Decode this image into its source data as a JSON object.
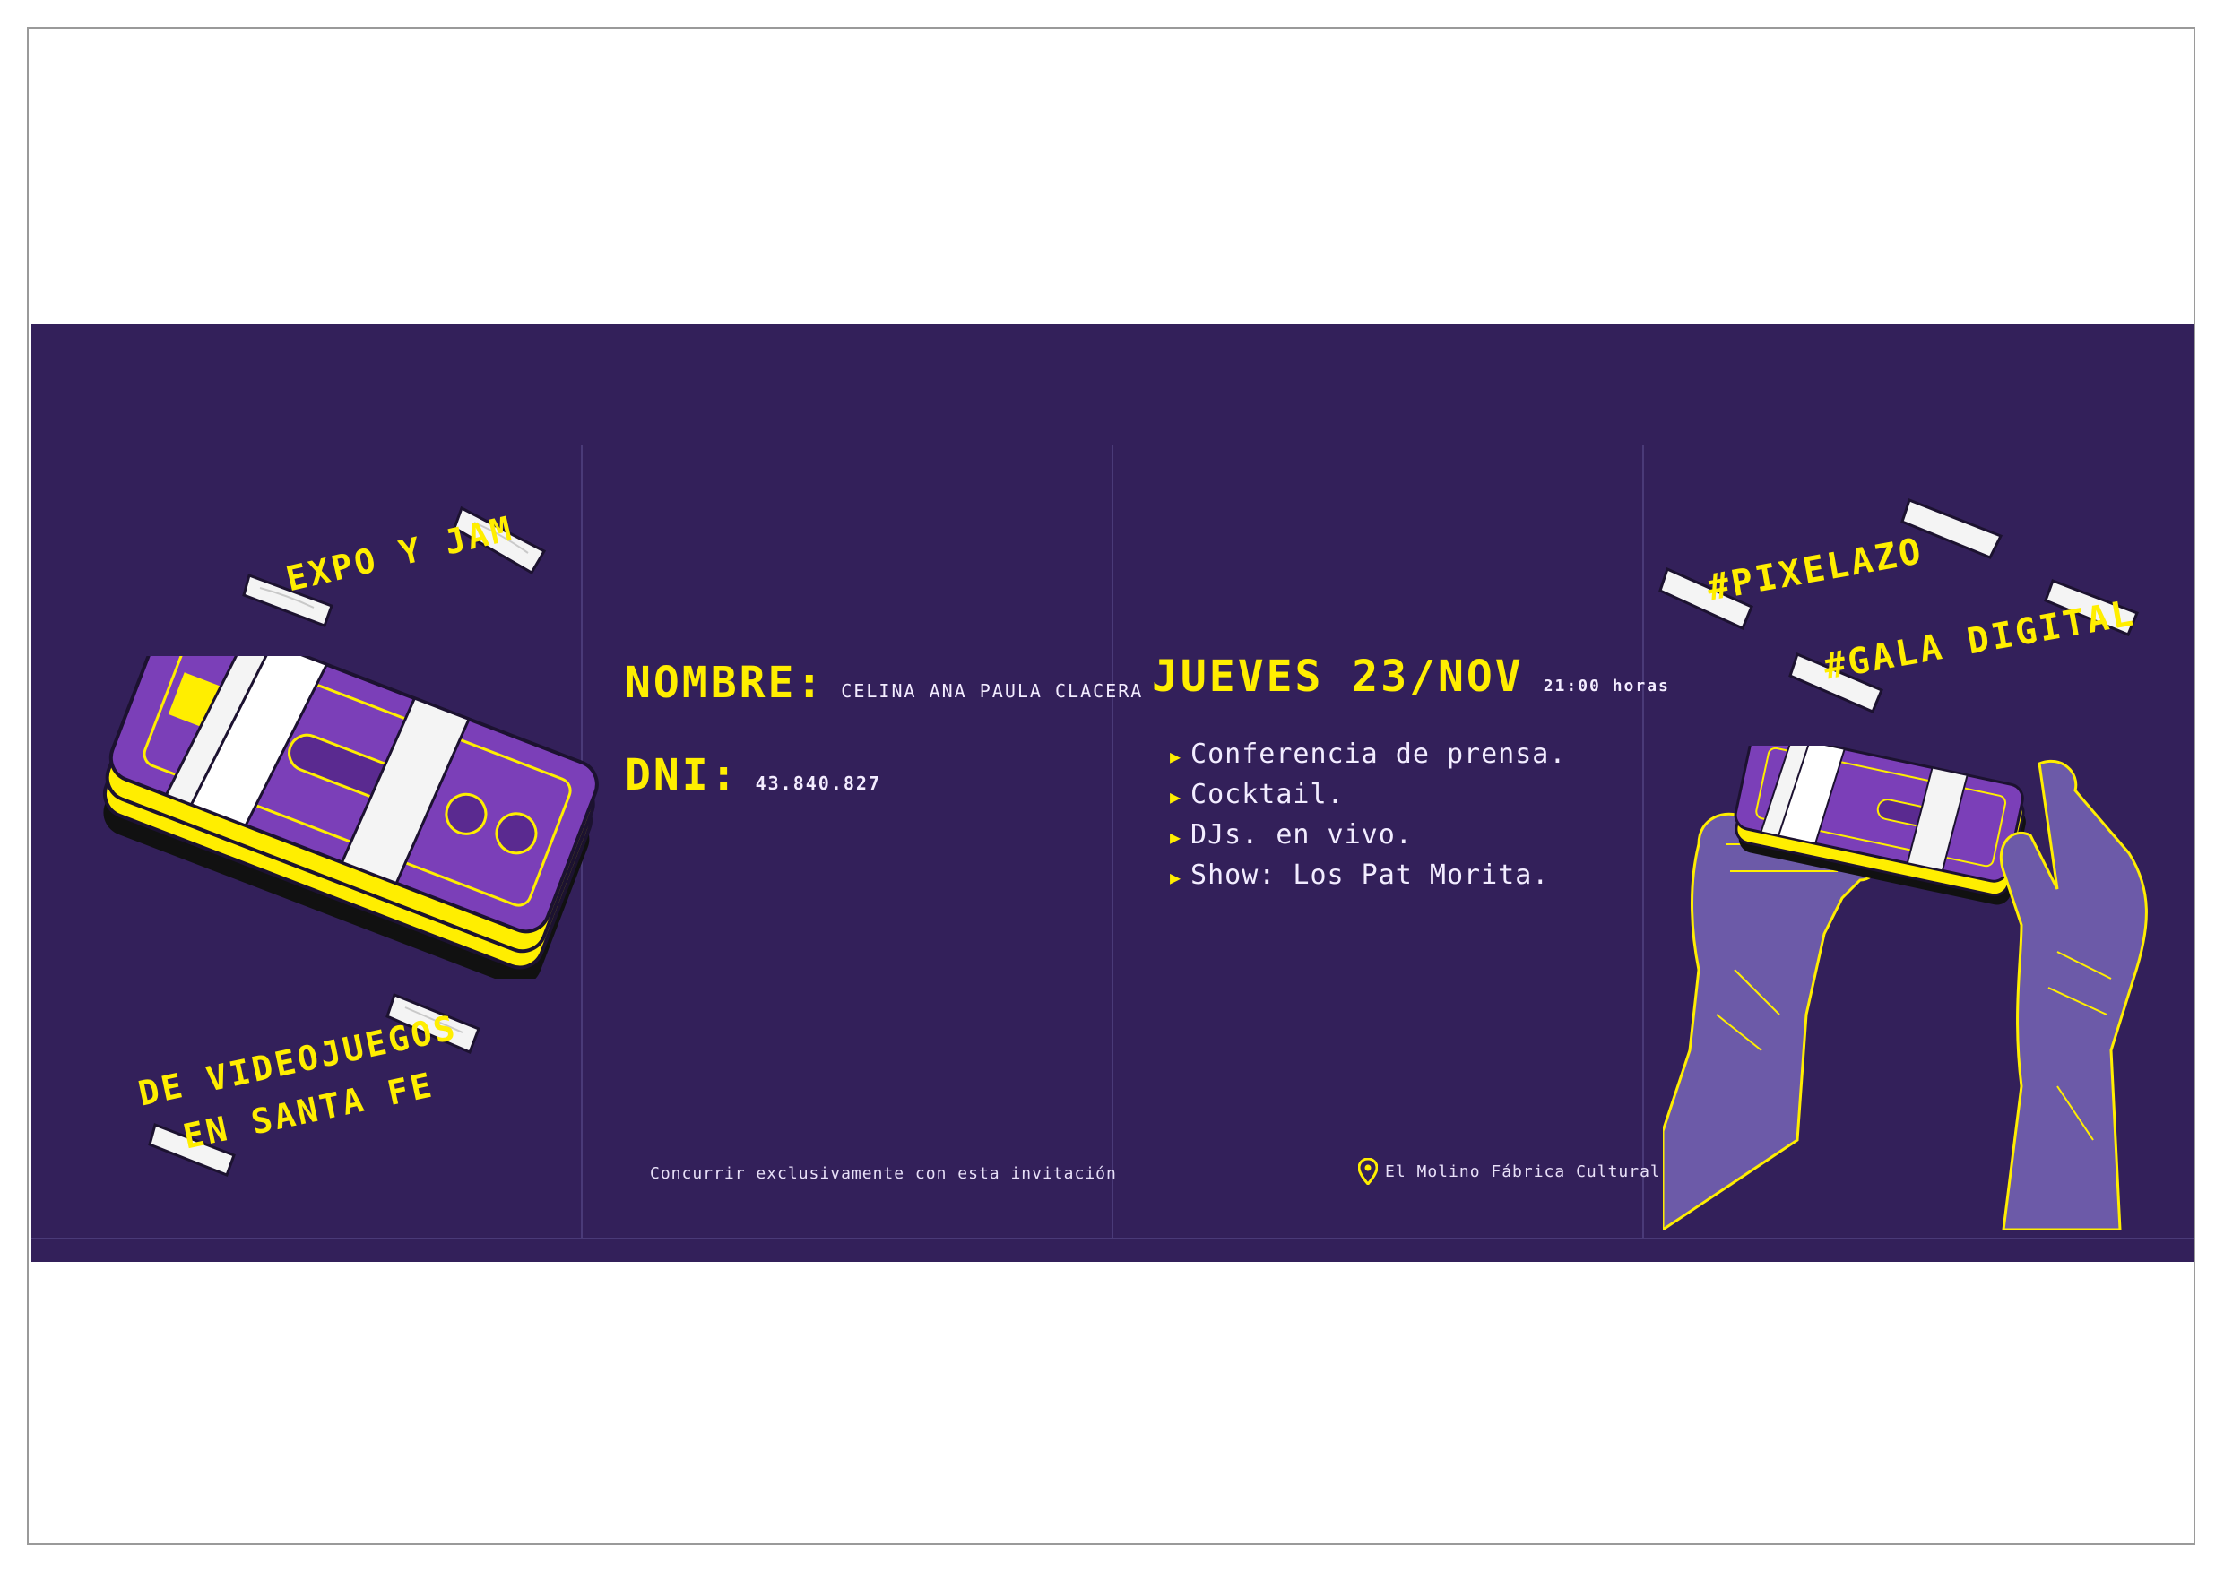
{
  "panel1": {
    "line1": "EXPO Y JAM",
    "line2": "DE VIDEOJUEGOS",
    "line3": "EN SANTA FE"
  },
  "panel2": {
    "name_label": "NOMBRE:",
    "name_value": "CELINA ANA PAULA CLACERA",
    "dni_label": "DNI:",
    "dni_value": "43.840.827",
    "footer": "Concurrir exclusivamente con esta invitación"
  },
  "panel3": {
    "date": "JUEVES 23/NOV",
    "time": "21:00 horas",
    "items": [
      "Conferencia de prensa.",
      "Cocktail.",
      "DJs. en vivo.",
      "Show: Los Pat Morita."
    ],
    "venue": "El Molino Fábrica Cultural"
  },
  "panel4": {
    "tag1": "#PIXELAZO",
    "tag2": "#GALA DIGITAL"
  },
  "colors": {
    "background": "#33205a",
    "accent_yellow": "#ffee00",
    "controller_purple": "#7b3fb8",
    "hand_purple": "#6c5aa8",
    "tape_white": "#f4f4f4"
  },
  "icons": [
    "controller-icon",
    "location-pin-icon",
    "triangle-bullet-icon",
    "tape-icon",
    "hand-icon"
  ]
}
